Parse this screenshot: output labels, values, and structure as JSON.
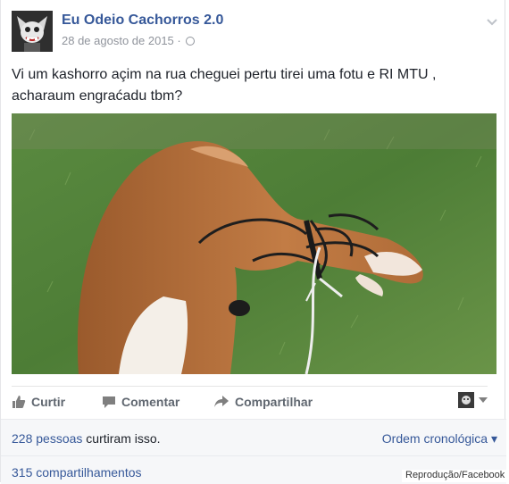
{
  "post": {
    "page_name": "Eu Odeio Cachorros 2.0",
    "date": "28 de agosto de 2015",
    "separator": "·",
    "text_line1": "Vi um kashorro açim na rua cheguei pertu tirei uma fotu e RI MTU ,",
    "text_line2": "acharaum engraćadu tbm?",
    "photo_icon": "dog-photo"
  },
  "actions": {
    "like_label": "Curtir",
    "comment_label": "Comentar",
    "share_label": "Compartilhar"
  },
  "reactions": {
    "count_link": "228 pessoas",
    "count_suffix": "curtiram isso.",
    "order_label": "Ordem cronológica",
    "order_arrow": "▾",
    "shares_label": "315 compartilhamentos"
  },
  "credit": "Reprodução/Facebook",
  "colors": {
    "link_blue": "#365899",
    "meta_gray": "#90949c",
    "action_gray": "#606770"
  }
}
